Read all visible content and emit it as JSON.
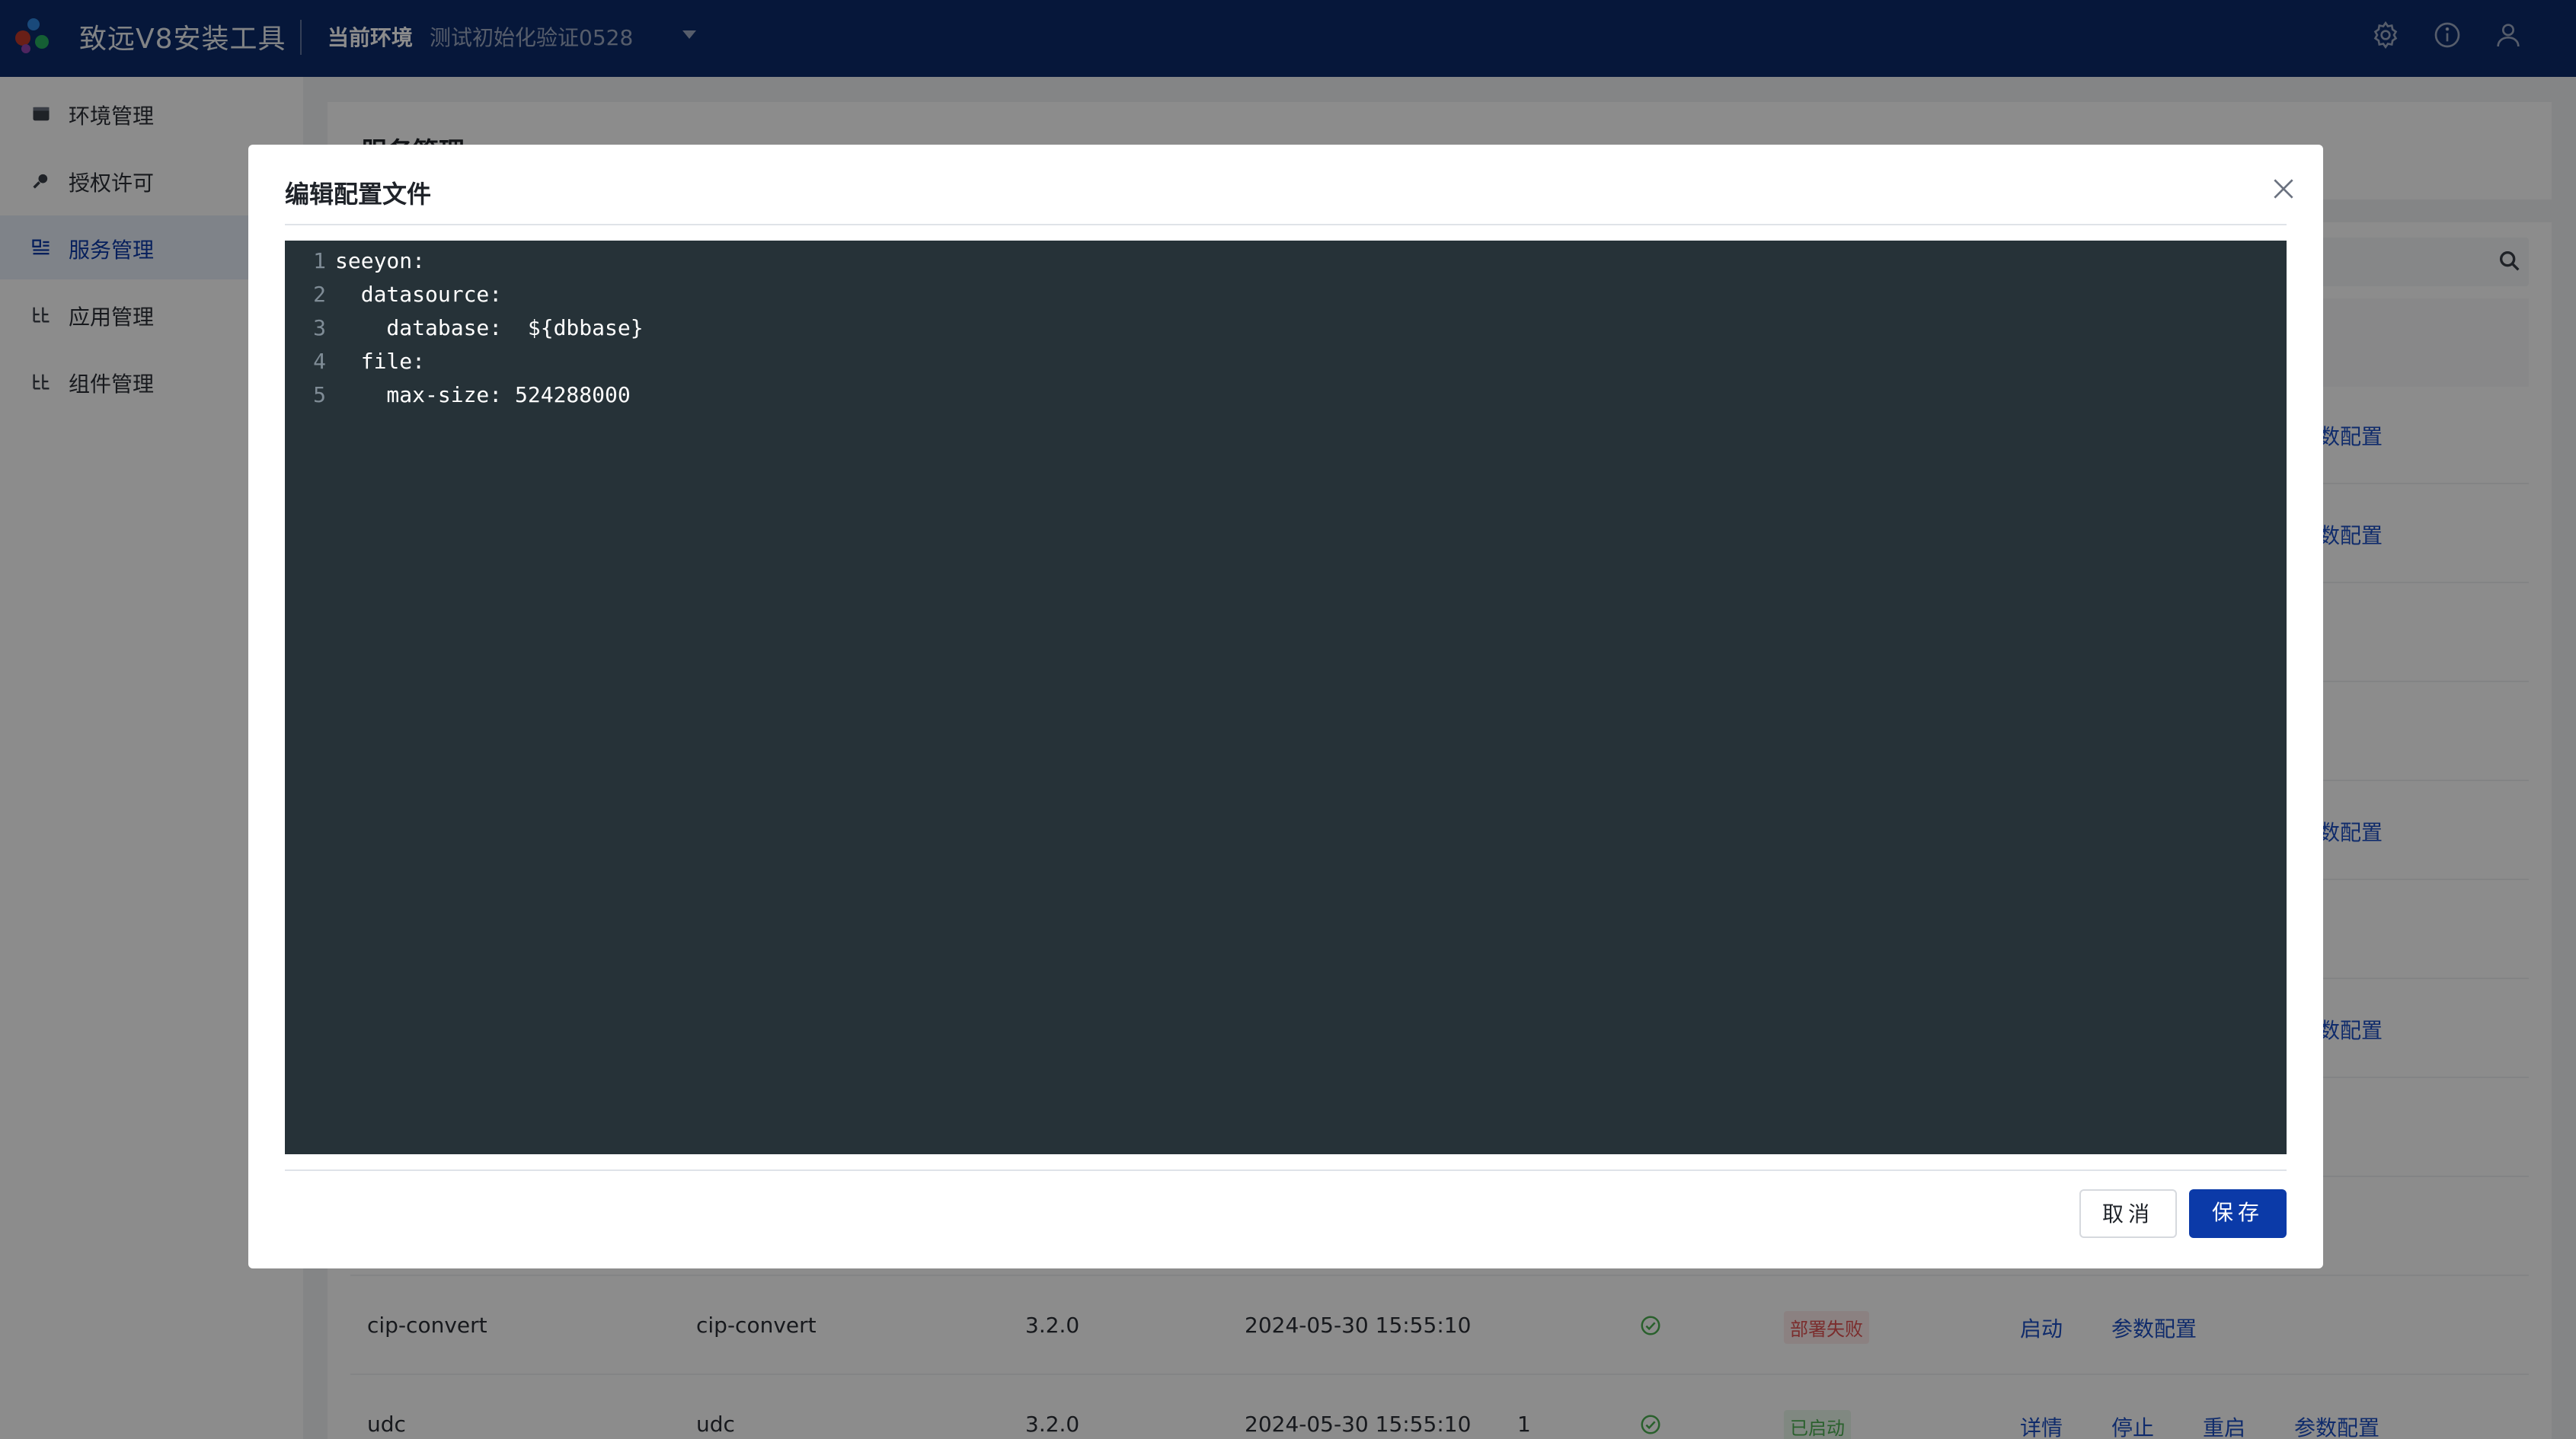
{
  "header": {
    "app_title": "致远V8安装工具",
    "env_label": "当前环境",
    "env_value": "测试初始化验证0528",
    "icons": [
      "gear-icon",
      "info-icon",
      "user-icon"
    ]
  },
  "sidebar": {
    "items": [
      {
        "label": "环境管理",
        "icon": "box-icon",
        "active": false
      },
      {
        "label": "授权许可",
        "icon": "key-icon",
        "active": false
      },
      {
        "label": "服务管理",
        "icon": "service-icon",
        "active": true
      },
      {
        "label": "应用管理",
        "icon": "app-icon",
        "active": false
      },
      {
        "label": "组件管理",
        "icon": "component-icon",
        "active": false
      }
    ]
  },
  "main": {
    "title": "服务管理",
    "rows": [
      {
        "name": "cip-convert",
        "service": "cip-convert",
        "version": "3.2.0",
        "time": "2024-05-30 15:55:10",
        "count": "",
        "status": "部署失败",
        "actions": [
          "启动",
          "参数配置"
        ]
      },
      {
        "name": "udc",
        "service": "udc",
        "version": "3.2.0",
        "time": "2024-05-30 15:55:10",
        "count": "1",
        "status": "已启动",
        "actions": [
          "详情",
          "停止",
          "重启",
          "参数配置"
        ]
      }
    ],
    "partial_links": [
      "数配置",
      "数配置",
      "数配置",
      "数配置"
    ]
  },
  "modal": {
    "title": "编辑配置文件",
    "code_lines": [
      {
        "num": "1",
        "text": "seeyon:"
      },
      {
        "num": "2",
        "text": "  datasource:"
      },
      {
        "num": "3",
        "text": "    database:  ${dbbase}"
      },
      {
        "num": "4",
        "text": "  file:"
      },
      {
        "num": "5",
        "text": "    max-size: 524288000"
      }
    ],
    "cancel_label": "取消",
    "save_label": "保存"
  },
  "colors": {
    "header_bg": "#0b2a6b",
    "primary": "#0b3aa8",
    "editor_bg": "#263238",
    "fail": "#e05252",
    "success": "#4caf50"
  }
}
